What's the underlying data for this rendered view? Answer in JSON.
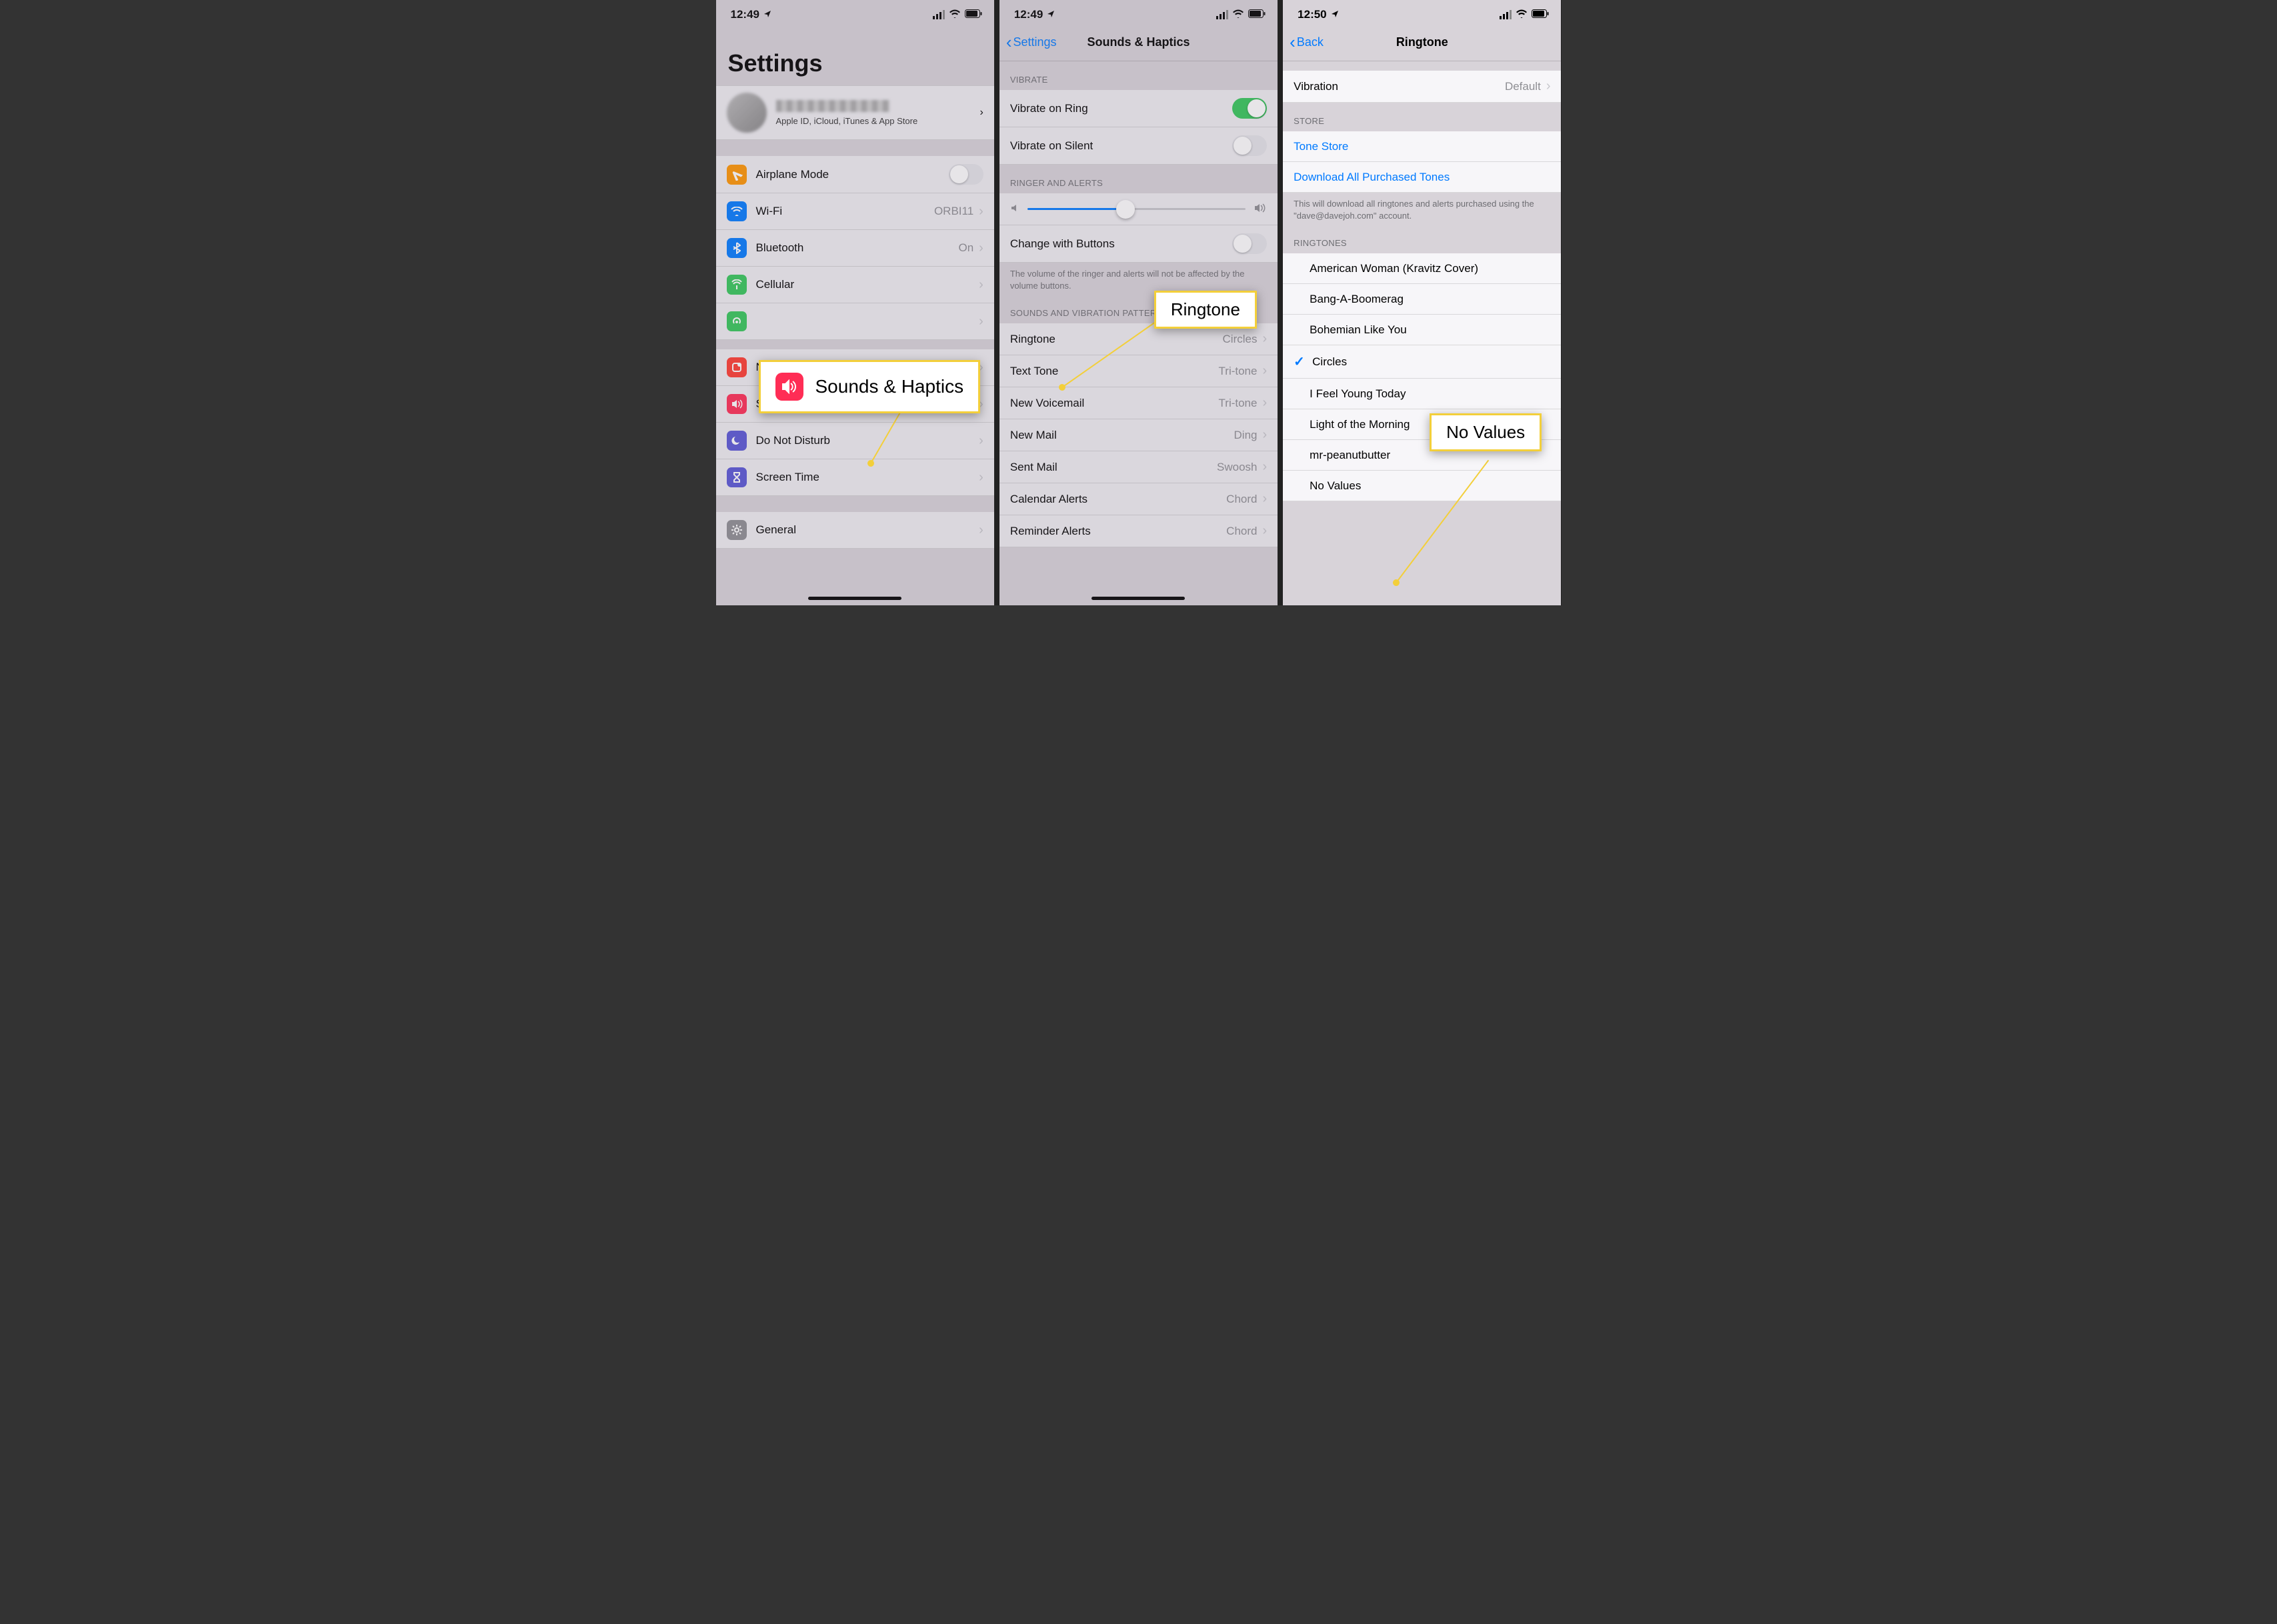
{
  "status": {
    "time1": "12:49",
    "time2": "12:49",
    "time3": "12:50"
  },
  "screen1": {
    "title": "Settings",
    "profile_sub": "Apple ID, iCloud, iTunes & App Store",
    "items": [
      {
        "icon": "airplane",
        "color": "#ff9500",
        "label": "Airplane Mode",
        "type": "toggle",
        "on": false
      },
      {
        "icon": "wifi",
        "color": "#007aff",
        "label": "Wi-Fi",
        "value": "ORBI11",
        "type": "nav"
      },
      {
        "icon": "bluetooth",
        "color": "#007aff",
        "label": "Bluetooth",
        "value": "On",
        "type": "nav"
      },
      {
        "icon": "cellular",
        "color": "#34c759",
        "label": "Cellular",
        "type": "nav"
      },
      {
        "icon": "hotspot",
        "color": "#34c759",
        "label": "",
        "type": "nav_cut"
      }
    ],
    "items2": [
      {
        "icon": "notifications",
        "color": "#ff3b30",
        "label": "Notifications",
        "type": "nav"
      },
      {
        "icon": "sounds",
        "color": "#ff2d55",
        "label": "Sounds & Haptics",
        "type": "nav"
      },
      {
        "icon": "dnd",
        "color": "#5856d6",
        "label": "Do Not Disturb",
        "type": "nav"
      },
      {
        "icon": "screentime",
        "color": "#5856d6",
        "label": "Screen Time",
        "type": "nav"
      }
    ],
    "items3": [
      {
        "icon": "general",
        "color": "#8e8e93",
        "label": "General",
        "type": "nav"
      }
    ],
    "callout_label": "Sounds & Haptics"
  },
  "screen2": {
    "back": "Settings",
    "title": "Sounds & Haptics",
    "sec_vibrate": "VIBRATE",
    "vibrate_ring": "Vibrate on Ring",
    "vibrate_silent": "Vibrate on Silent",
    "sec_ringer": "RINGER AND ALERTS",
    "change_buttons": "Change with Buttons",
    "ringer_footer": "The volume of the ringer and alerts will not be affected by the volume buttons.",
    "sec_patterns": "SOUNDS AND VIBRATION PATTERNS",
    "patterns": [
      {
        "label": "Ringtone",
        "value": "Circles"
      },
      {
        "label": "Text Tone",
        "value": "Tri-tone"
      },
      {
        "label": "New Voicemail",
        "value": "Tri-tone"
      },
      {
        "label": "New Mail",
        "value": "Ding"
      },
      {
        "label": "Sent Mail",
        "value": "Swoosh"
      },
      {
        "label": "Calendar Alerts",
        "value": "Chord"
      },
      {
        "label": "Reminder Alerts",
        "value": "Chord"
      }
    ],
    "callout_label": "Ringtone",
    "slider_pct": 45
  },
  "screen3": {
    "back": "Back",
    "title": "Ringtone",
    "vibration_label": "Vibration",
    "vibration_value": "Default",
    "sec_store": "STORE",
    "tone_store": "Tone Store",
    "download_all": "Download All Purchased Tones",
    "store_footer": "This will download all ringtones and alerts purchased using the \"dave@davejoh.com\" account.",
    "sec_ringtones": "RINGTONES",
    "ringtones": [
      {
        "label": "American Woman (Kravitz Cover)",
        "checked": false
      },
      {
        "label": "Bang-A-Boomerag",
        "checked": false
      },
      {
        "label": "Bohemian Like You",
        "checked": false
      },
      {
        "label": "Circles",
        "checked": true
      },
      {
        "label": "I Feel Young Today",
        "checked": false
      },
      {
        "label": "Light of the Morning",
        "checked": false
      },
      {
        "label": "mr-peanutbutter",
        "checked": false
      },
      {
        "label": "No Values",
        "checked": false
      }
    ],
    "callout_label": "No Values"
  }
}
